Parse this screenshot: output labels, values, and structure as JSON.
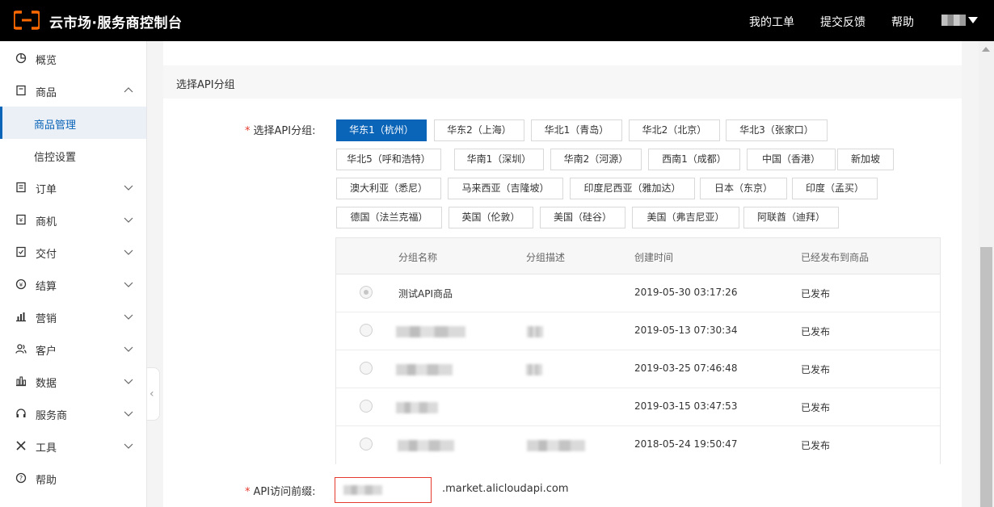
{
  "header": {
    "title": "云市场·服务商控制台",
    "nav": [
      "我的工单",
      "提交反馈",
      "帮助"
    ]
  },
  "sidebar": {
    "items": [
      {
        "label": "概览",
        "icon": "pie-chart-icon"
      },
      {
        "label": "商品",
        "icon": "document-icon",
        "expanded": true
      },
      {
        "label": "商品管理",
        "sub": true,
        "active": true
      },
      {
        "label": "信控设置",
        "sub": true
      },
      {
        "label": "订单",
        "icon": "list-icon"
      },
      {
        "label": "商机",
        "icon": "receipt-icon"
      },
      {
        "label": "交付",
        "icon": "delivery-icon"
      },
      {
        "label": "结算",
        "icon": "yen-icon"
      },
      {
        "label": "营销",
        "icon": "bar-chart-icon"
      },
      {
        "label": "客户",
        "icon": "users-icon"
      },
      {
        "label": "数据",
        "icon": "column-chart-icon"
      },
      {
        "label": "服务商",
        "icon": "headset-icon"
      },
      {
        "label": "工具",
        "icon": "tools-icon"
      },
      {
        "label": "帮助",
        "icon": "help-icon"
      }
    ]
  },
  "section": {
    "title": "选择API分组"
  },
  "form": {
    "group_label": "选择API分组:",
    "regions": [
      "华东1（杭州）",
      "华东2（上海）",
      "华北1（青岛）",
      "华北2（北京）",
      "华北3（张家口）",
      "华北5（呼和浩特）",
      "华南1（深圳）",
      "华南2（河源）",
      "西南1（成都）",
      "中国（香港）",
      "新加坡",
      "澳大利亚（悉尼）",
      "马来西亚（吉隆坡）",
      "印度尼西亚（雅加达）",
      "日本（东京）",
      "印度（孟买）",
      "德国（法兰克福）",
      "英国（伦敦）",
      "美国（硅谷）",
      "美国（弗吉尼亚）",
      "阿联酋（迪拜）"
    ],
    "selected_region": "华东1（杭州）",
    "table": {
      "headers": [
        "分组名称",
        "分组描述",
        "创建时间",
        "已经发布到商品"
      ],
      "rows": [
        {
          "name": "测试API商品",
          "desc": "",
          "created": "2019-05-30 03:17:26",
          "status": "已发布",
          "checked": true
        },
        {
          "name": "",
          "desc": "",
          "created": "2019-05-13 07:30:34",
          "status": "已发布",
          "checked": false
        },
        {
          "name": "",
          "desc": "",
          "created": "2019-03-25 07:46:48",
          "status": "已发布",
          "checked": false
        },
        {
          "name": "",
          "desc": "",
          "created": "2019-03-15 03:47:53",
          "status": "已发布",
          "checked": false
        },
        {
          "name": "",
          "desc": "",
          "created": "2018-05-24 19:50:47",
          "status": "已发布",
          "checked": false
        }
      ]
    },
    "prefix_label": "API访问前缀:",
    "prefix_suffix": ".market.alicloudapi.com"
  },
  "colors": {
    "accent": "#0a64b8",
    "error": "#e5392d",
    "topbar": "#000000",
    "logo": "#ff6a00"
  }
}
